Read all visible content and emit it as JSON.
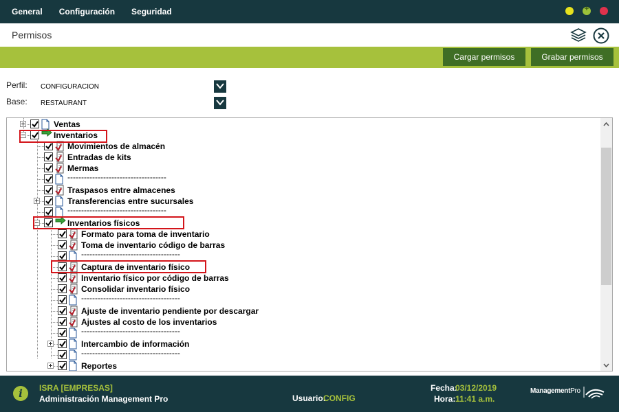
{
  "menu": {
    "general": "General",
    "config": "Configuración",
    "security": "Seguridad"
  },
  "window": {
    "title": "Permisos"
  },
  "toolbar": {
    "load_label": "Cargar permisos",
    "save_label": "Grabar permisos"
  },
  "profile": {
    "label": "Perfil:",
    "value": "CONFIGURACION"
  },
  "base": {
    "label": "Base:",
    "value": "RESTAURANT"
  },
  "tree": {
    "ventas": "Ventas",
    "inventarios": "Inventarios",
    "movimientos": "Movimientos de almacén",
    "entradas_kits": "Entradas de kits",
    "mermas": "Mermas",
    "separator": "------------------------------------",
    "traspasos": "Traspasos entre almacenes",
    "transferencias": "Transferencias entre sucursales",
    "inventarios_fisicos": "Inventarios físicos",
    "formato_toma": "Formato para toma de inventario",
    "toma_barras": "Toma de inventario código de barras",
    "captura": "Captura de inventario físico",
    "fisico_barras": "Inventario físico por código de barras",
    "consolidar": "Consolidar inventario físico",
    "ajuste_pendiente": "Ajuste de inventario pendiente por descargar",
    "ajustes_costo": "Ajustes al costo de los inventarios",
    "intercambio": "Intercambio de información",
    "reportes": "Reportes"
  },
  "footer": {
    "company": "ISRA [EMPRESAS]",
    "app": "Administración Management Pro",
    "user_label": "Usuario:",
    "user_value": "CONFIG",
    "date_label": "Fecha:",
    "date_value": "03/12/2019",
    "time_label": "Hora:",
    "time_value": "11:41 a.m.",
    "logo_a": "Management",
    "logo_b": "Pro"
  },
  "colors": {
    "dark": "#17383f",
    "green": "#a6c13c",
    "button": "#3f6e25",
    "highlight": "#d3141a"
  }
}
